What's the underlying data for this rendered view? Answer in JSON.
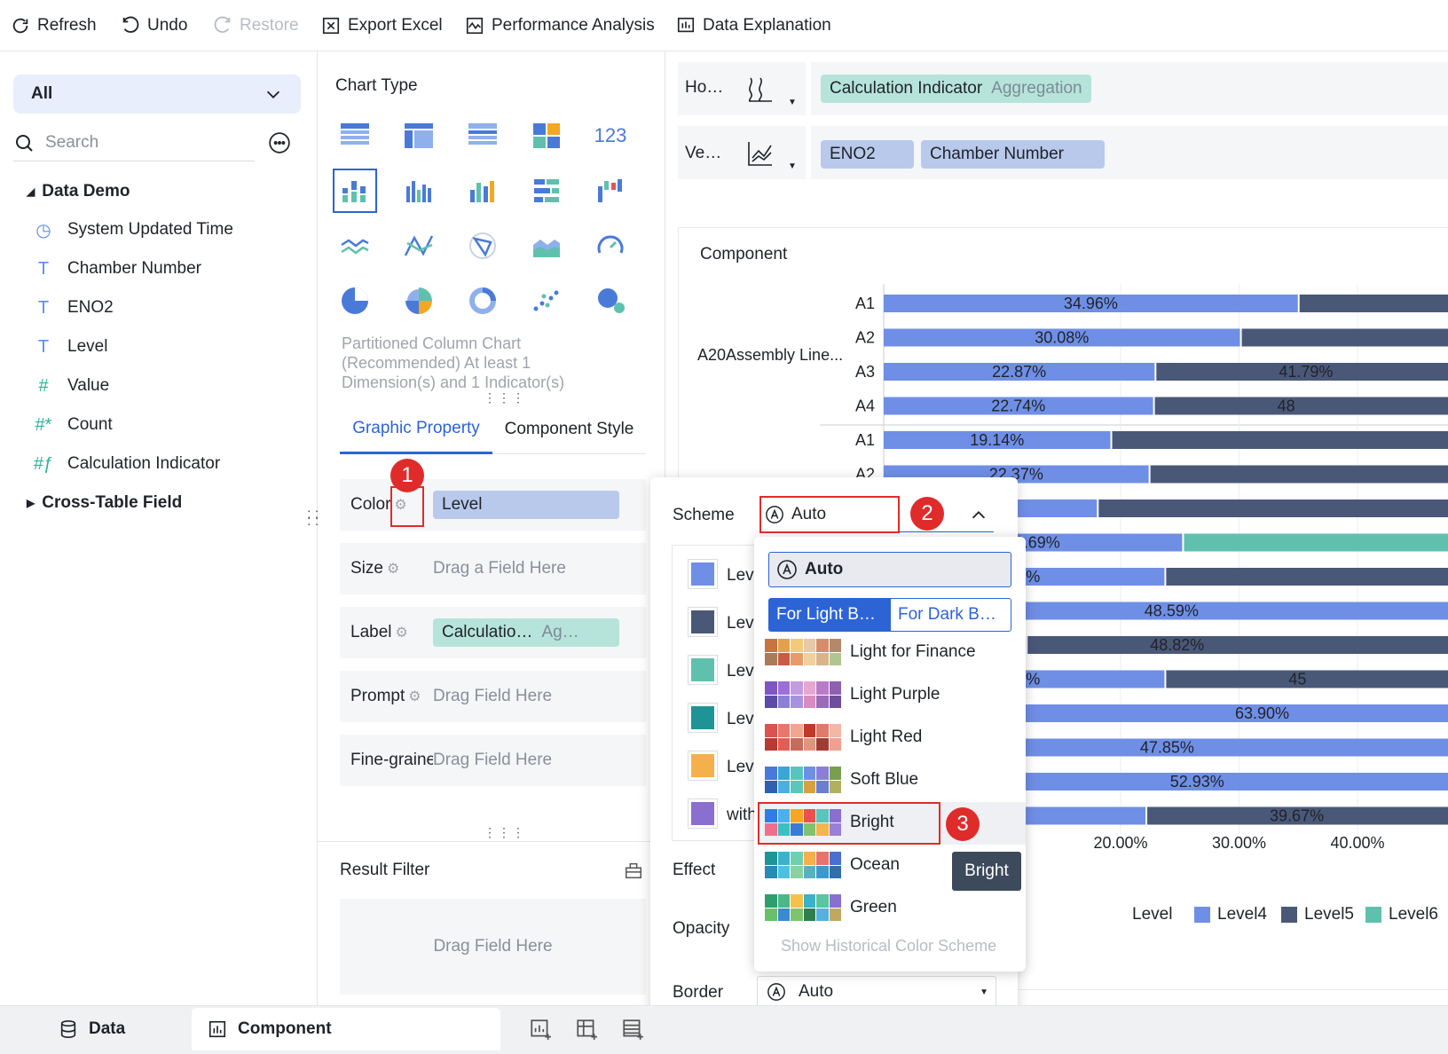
{
  "toolbar": {
    "refresh": "Refresh",
    "undo": "Undo",
    "restore": "Restore",
    "export_excel": "Export Excel",
    "performance": "Performance Analysis",
    "data_explanation": "Data Explanation"
  },
  "left": {
    "select_value": "All",
    "search_placeholder": "Search",
    "group_title": "Data Demo",
    "fields": [
      {
        "label": "System Updated Time",
        "icon": "clock-icon"
      },
      {
        "label": "Chamber Number",
        "icon": "text-type-icon"
      },
      {
        "label": "ENO2",
        "icon": "text-type-icon"
      },
      {
        "label": "Level",
        "icon": "text-type-icon"
      },
      {
        "label": "Value",
        "icon": "number-type-icon"
      },
      {
        "label": "Count",
        "icon": "count-type-icon"
      },
      {
        "label": "Calculation Indicator",
        "icon": "calc-indicator-icon"
      }
    ],
    "cross_table": "Cross-Table Field"
  },
  "middle": {
    "chart_type_title": "Chart Type",
    "chart_type_desc": "Partitioned Column Chart (Recommended) At least 1 Dimension(s) and 1 Indicator(s)",
    "tabs": [
      "Graphic Property",
      "Component Style"
    ],
    "props": {
      "color_label": "Color",
      "color_value": "Level",
      "size_label": "Size",
      "size_placeholder": "Drag a Field Here",
      "label_label": "Label",
      "label_value": "Calculatio…",
      "label_agg": "Ag…",
      "prompt_label": "Prompt",
      "prompt_placeholder": "Drag Field Here",
      "fine_label": "Fine-graine",
      "fine_placeholder": "Drag Field Here"
    },
    "result_filter": "Result Filter",
    "result_placeholder": "Drag Field Here"
  },
  "axes": {
    "horizontal_label": "Ho…",
    "vertical_label": "Ve…",
    "h_pill": "Calculation Indicator",
    "h_pill_agg": "Aggregation",
    "v_pill1": "ENO2",
    "v_pill2": "Chamber Number"
  },
  "chart_data": {
    "type": "bar",
    "title": "Component",
    "group_label": "A20Assembly Line...",
    "rows": [
      {
        "category": "A1",
        "label": "34.96%",
        "values": [
          34.96
        ]
      },
      {
        "category": "A2",
        "label": "30.08%",
        "values": [
          30.08
        ]
      },
      {
        "category": "A3",
        "label": "22.87%",
        "values": [
          22.87
        ],
        "label2": "41.79%"
      },
      {
        "category": "A4",
        "label": "22.74%",
        "values": [
          22.74
        ],
        "label2": "48"
      },
      {
        "category": "A1",
        "label": "19.14%",
        "values": [
          19.14
        ]
      },
      {
        "category": "A2",
        "label": "22.37%",
        "values": [
          22.37
        ]
      },
      {
        "category": "",
        "label": "%",
        "values": [
          18
        ]
      },
      {
        "category": "",
        "label": "23.69%",
        "values": [
          25.2
        ]
      },
      {
        "category": "",
        "label": "93%",
        "values": [
          23.7
        ]
      },
      {
        "category": "",
        "label": "48.59%",
        "values": [
          48.59
        ]
      },
      {
        "category": "",
        "label": "",
        "values": [
          12
        ],
        "label2": "48.82%"
      },
      {
        "category": "",
        "label": "87%",
        "values": [
          23.7
        ],
        "label2": "45"
      },
      {
        "category": "",
        "label": "63.90%",
        "values": [
          63.9
        ]
      },
      {
        "category": "",
        "label": "47.85%",
        "values": [
          47.85
        ]
      },
      {
        "category": "",
        "label": "52.93%",
        "values": [
          52.93
        ]
      },
      {
        "category": "",
        "label": "5%",
        "values": [
          22.1
        ],
        "label2": "39.67%"
      }
    ],
    "x_ticks": [
      "20.00%",
      "30.00%",
      "40.00%"
    ],
    "legend_title": "Level",
    "legend": [
      {
        "name": "Level4",
        "color": "#6f8fe6"
      },
      {
        "name": "Level5",
        "color": "#4a5878"
      },
      {
        "name": "Level6",
        "color": "#5fc1ad"
      }
    ]
  },
  "popover": {
    "scheme_label": "Scheme",
    "scheme_value": "Auto",
    "effect_label": "Effect",
    "opacity_label": "Opacity",
    "border_label": "Border",
    "border_value": "Auto",
    "legend_items": [
      {
        "label": "Lev",
        "color": "#6f8fe6"
      },
      {
        "label": "Lev",
        "color": "#4a5878"
      },
      {
        "label": "Lev",
        "color": "#5fc1ad"
      },
      {
        "label": "Lev",
        "color": "#1f9497"
      },
      {
        "label": "Lev",
        "color": "#f5b04b"
      },
      {
        "label": "with",
        "color": "#8a6fd1"
      }
    ]
  },
  "dropdown": {
    "auto": "Auto",
    "tab_light": "For Light B…",
    "tab_dark": "For Dark B…",
    "schemes": [
      {
        "name": "Light for Finance",
        "colors": [
          "#c9743f",
          "#e3a14b",
          "#f5c97a",
          "#e7c9a8",
          "#d88d6a",
          "#b3896b",
          "#a87b5a",
          "#c95c44",
          "#e89a6b",
          "#f0d0a0",
          "#d9b48a",
          "#b0c690"
        ]
      },
      {
        "name": "Light Purple",
        "colors": [
          "#7e57c2",
          "#9c6fd6",
          "#c39be0",
          "#e6a8d0",
          "#b77bc8",
          "#8f5fb0",
          "#5e4aa8",
          "#8c7fd6",
          "#a693e0",
          "#d98cc0",
          "#9b6bb8",
          "#6f4d9e"
        ]
      },
      {
        "name": "Light Red",
        "colors": [
          "#d9534f",
          "#e8776b",
          "#f2a68f",
          "#c0392b",
          "#e07a6a",
          "#f4b7a6",
          "#b83a34",
          "#e35d55",
          "#c96a5e",
          "#e29480",
          "#a33a34",
          "#f0a090"
        ]
      },
      {
        "name": "Soft Blue",
        "colors": [
          "#4a7ad8",
          "#3ba5d6",
          "#58c4c0",
          "#6f8fe6",
          "#8a7fd6",
          "#7a9e50",
          "#2f5fb0",
          "#4ab0e0",
          "#5cc7b8",
          "#d8a040",
          "#6a7fd0",
          "#b0b060"
        ]
      },
      {
        "name": "Bright",
        "colors": [
          "#2f7ee6",
          "#4bb0f0",
          "#f5a623",
          "#e8524f",
          "#5ac5b8",
          "#8a6fd1",
          "#f06e8c",
          "#3bc0c0",
          "#3a7bd5",
          "#7fc36e",
          "#f2b64c",
          "#9a7fd8"
        ]
      },
      {
        "name": "Ocean",
        "colors": [
          "#1f9497",
          "#3bb2c9",
          "#6fcfb0",
          "#f5b04b",
          "#e8736a",
          "#4a6fd0",
          "#2a8ab0",
          "#4fc0e0",
          "#8ad0a0",
          "#5ab0c0",
          "#3a9ad0",
          "#2f6fb0"
        ]
      },
      {
        "name": "Green",
        "colors": [
          "#2f9e6f",
          "#4bb88a",
          "#f5c14b",
          "#3bb2c9",
          "#5ac5a0",
          "#8a6fd1",
          "#6abf6a",
          "#3a8ad0",
          "#7fc36e",
          "#2f7e4f",
          "#58b0e0",
          "#c0a860"
        ]
      }
    ],
    "historical": "Show Historical Color Scheme",
    "tooltip": "Bright"
  },
  "badges": [
    "1",
    "2",
    "3"
  ],
  "bottom": {
    "data_tab": "Data",
    "component_tab": "Component"
  }
}
